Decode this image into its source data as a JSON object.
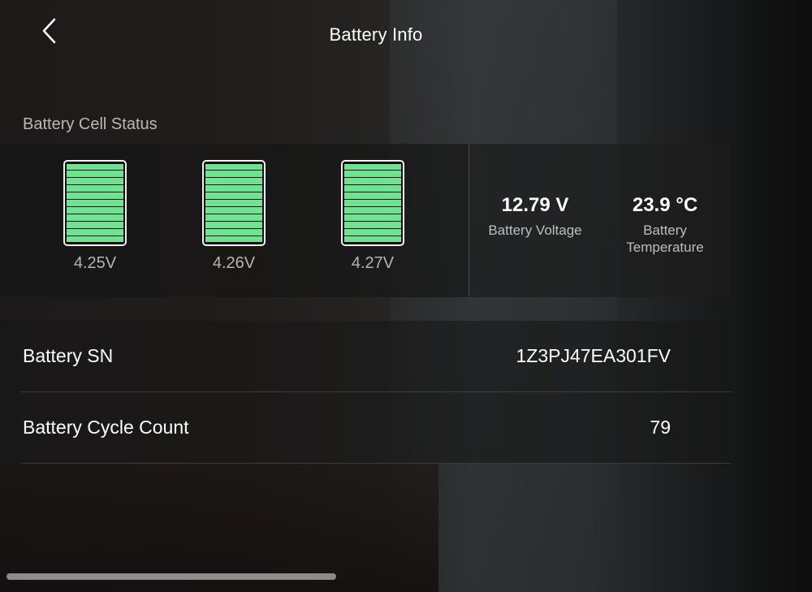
{
  "header": {
    "title": "Battery Info",
    "back_icon": "chevron-left-icon"
  },
  "cell_status": {
    "section_label": "Battery Cell Status",
    "cells": [
      {
        "voltage": "4.25V",
        "fill_level": 1.0
      },
      {
        "voltage": "4.26V",
        "fill_level": 1.0
      },
      {
        "voltage": "4.27V",
        "fill_level": 1.0
      }
    ],
    "cell_color": "#6ee391"
  },
  "stats": {
    "voltage": {
      "value": "12.79 V",
      "label": "Battery Voltage"
    },
    "temperature": {
      "value": "23.9 °C",
      "label_line1": "Battery",
      "label_line2": "Temperature"
    }
  },
  "info": {
    "rows": [
      {
        "label": "Battery SN",
        "value": "1Z3PJ47EA301FV"
      },
      {
        "label": "Battery Cycle Count",
        "value": "79"
      }
    ]
  }
}
